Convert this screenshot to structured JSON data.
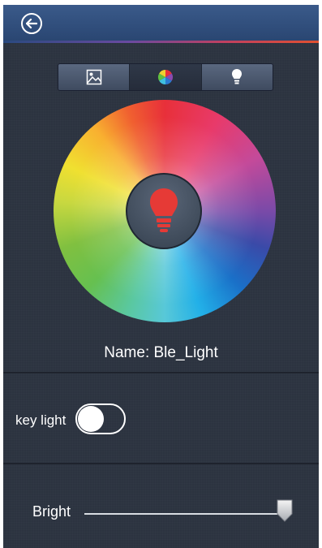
{
  "header": {
    "back_icon": "back-arrow-icon"
  },
  "tabs": [
    {
      "icon": "image-icon",
      "active": false
    },
    {
      "icon": "color-wheel-icon",
      "active": true
    },
    {
      "icon": "bulb-icon",
      "active": false
    }
  ],
  "color_picker": {
    "center_icon": "bulb-icon",
    "center_color": "#e63a36"
  },
  "device": {
    "name_label": "Name: Ble_Light"
  },
  "key_light": {
    "label": "key light",
    "enabled": false
  },
  "brightness": {
    "label": "Bright",
    "value_fraction": 1.0
  }
}
